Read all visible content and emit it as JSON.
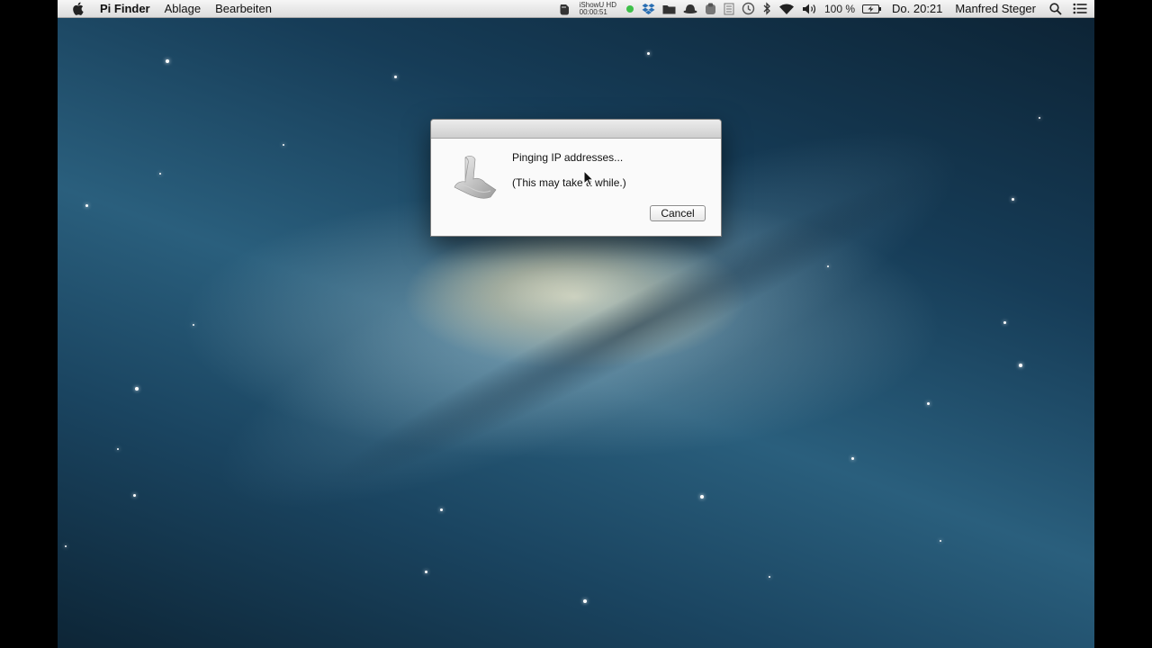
{
  "menubar": {
    "app_name": "Pi Finder",
    "menus": [
      "Ablage",
      "Bearbeiten"
    ],
    "ishowu": {
      "name": "iShowU HD",
      "time": "00:00:51"
    },
    "battery_percent": "100 %",
    "clock": "Do. 20:21",
    "user": "Manfred Steger",
    "icons": [
      "apple-logo",
      "evernote",
      "ishowu-hd",
      "status-green-dot",
      "dropbox",
      "folder",
      "hat",
      "app-icon",
      "bars",
      "time-machine",
      "bluetooth",
      "wifi",
      "volume",
      "battery",
      "spotlight",
      "notification-center"
    ]
  },
  "dialog": {
    "message": "Pinging IP addresses...",
    "detail": "(This may take a while.)",
    "cancel_label": "Cancel"
  },
  "colors": {
    "menubar_bg": "#e8e8e8",
    "dialog_bg": "#fafafa",
    "status_green": "#3ec04a"
  }
}
